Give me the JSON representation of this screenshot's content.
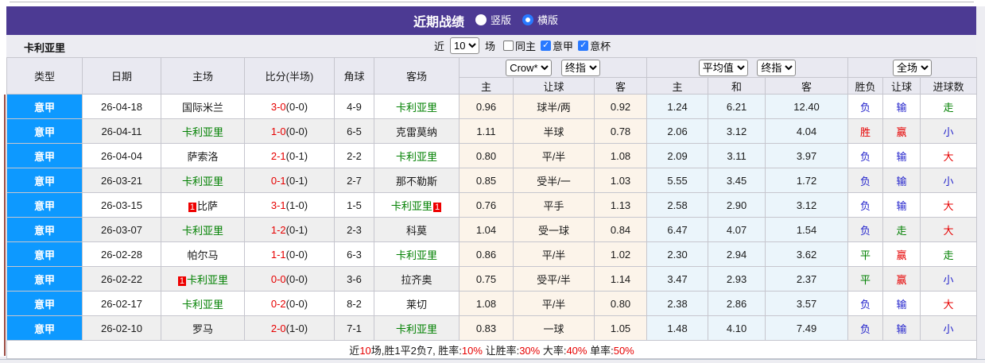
{
  "titlebar": {
    "title": "近期战绩",
    "radios": [
      {
        "label": "竖版",
        "checked": false
      },
      {
        "label": "横版",
        "checked": true
      }
    ]
  },
  "filter": {
    "team": "卡利亚里",
    "near_label": "近",
    "count_value": "10",
    "games_label": "场",
    "checkboxes": [
      {
        "label": "同主",
        "checked": false
      },
      {
        "label": "意甲",
        "checked": true
      },
      {
        "label": "意杯",
        "checked": true
      }
    ]
  },
  "header": {
    "cols": [
      "类型",
      "日期",
      "主场",
      "比分(半场)",
      "角球",
      "客场"
    ],
    "selects": {
      "crow": "Crow*",
      "final1": "终指",
      "avg": "平均值",
      "final2": "终指",
      "full": "全场"
    },
    "sub": [
      "主",
      "让球",
      "客",
      "主",
      "和",
      "客",
      "胜负",
      "让球",
      "进球数"
    ]
  },
  "rows": [
    {
      "league": "意甲",
      "date": "26-04-18",
      "home": "国际米兰",
      "home_color": "black",
      "home_badge_pre": "",
      "home_badge_suf": "",
      "score_ft": "3-0",
      "score_ht": "(0-0)",
      "corners": "4-9",
      "away": "卡利亚里",
      "away_color": "green",
      "away_badge_pre": "",
      "away_badge_suf": "",
      "odd_home": "0.96",
      "odd_line": "球半/两",
      "odd_away": "0.92",
      "avg_home": "1.24",
      "avg_draw": "6.21",
      "avg_away": "12.40",
      "res_wdl": "负",
      "res_wdl_c": "blue",
      "res_let": "输",
      "res_let_c": "blue",
      "res_goal": "走",
      "res_goal_c": "green"
    },
    {
      "league": "意甲",
      "date": "26-04-11",
      "home": "卡利亚里",
      "home_color": "green",
      "home_badge_pre": "",
      "home_badge_suf": "",
      "score_ft": "1-0",
      "score_ht": "(0-0)",
      "corners": "6-5",
      "away": "克雷莫纳",
      "away_color": "black",
      "away_badge_pre": "",
      "away_badge_suf": "",
      "odd_home": "1.11",
      "odd_line": "半球",
      "odd_away": "0.78",
      "avg_home": "2.06",
      "avg_draw": "3.12",
      "avg_away": "4.04",
      "res_wdl": "胜",
      "res_wdl_c": "red",
      "res_let": "赢",
      "res_let_c": "red",
      "res_goal": "小",
      "res_goal_c": "blue"
    },
    {
      "league": "意甲",
      "date": "26-04-04",
      "home": "萨索洛",
      "home_color": "black",
      "home_badge_pre": "",
      "home_badge_suf": "",
      "score_ft": "2-1",
      "score_ht": "(0-1)",
      "corners": "2-2",
      "away": "卡利亚里",
      "away_color": "green",
      "away_badge_pre": "",
      "away_badge_suf": "",
      "odd_home": "0.80",
      "odd_line": "平/半",
      "odd_away": "1.08",
      "avg_home": "2.09",
      "avg_draw": "3.11",
      "avg_away": "3.97",
      "res_wdl": "负",
      "res_wdl_c": "blue",
      "res_let": "输",
      "res_let_c": "blue",
      "res_goal": "大",
      "res_goal_c": "red"
    },
    {
      "league": "意甲",
      "date": "26-03-21",
      "home": "卡利亚里",
      "home_color": "green",
      "home_badge_pre": "",
      "home_badge_suf": "",
      "score_ft": "0-1",
      "score_ht": "(0-1)",
      "corners": "2-7",
      "away": "那不勒斯",
      "away_color": "black",
      "away_badge_pre": "",
      "away_badge_suf": "",
      "odd_home": "0.85",
      "odd_line": "受半/一",
      "odd_away": "1.03",
      "avg_home": "5.55",
      "avg_draw": "3.45",
      "avg_away": "1.72",
      "res_wdl": "负",
      "res_wdl_c": "blue",
      "res_let": "输",
      "res_let_c": "blue",
      "res_goal": "小",
      "res_goal_c": "blue"
    },
    {
      "league": "意甲",
      "date": "26-03-15",
      "home": "比萨",
      "home_color": "black",
      "home_badge_pre": "1",
      "home_badge_suf": "",
      "score_ft": "3-1",
      "score_ht": "(1-0)",
      "corners": "1-5",
      "away": "卡利亚里",
      "away_color": "green",
      "away_badge_pre": "",
      "away_badge_suf": "1",
      "odd_home": "0.76",
      "odd_line": "平手",
      "odd_away": "1.13",
      "avg_home": "2.58",
      "avg_draw": "2.90",
      "avg_away": "3.12",
      "res_wdl": "负",
      "res_wdl_c": "blue",
      "res_let": "输",
      "res_let_c": "blue",
      "res_goal": "大",
      "res_goal_c": "red"
    },
    {
      "league": "意甲",
      "date": "26-03-07",
      "home": "卡利亚里",
      "home_color": "green",
      "home_badge_pre": "",
      "home_badge_suf": "",
      "score_ft": "1-2",
      "score_ht": "(0-1)",
      "corners": "2-3",
      "away": "科莫",
      "away_color": "black",
      "away_badge_pre": "",
      "away_badge_suf": "",
      "odd_home": "1.04",
      "odd_line": "受一球",
      "odd_away": "0.84",
      "avg_home": "6.47",
      "avg_draw": "4.07",
      "avg_away": "1.54",
      "res_wdl": "负",
      "res_wdl_c": "blue",
      "res_let": "走",
      "res_let_c": "green",
      "res_goal": "大",
      "res_goal_c": "red"
    },
    {
      "league": "意甲",
      "date": "26-02-28",
      "home": "帕尔马",
      "home_color": "black",
      "home_badge_pre": "",
      "home_badge_suf": "",
      "score_ft": "1-1",
      "score_ht": "(0-0)",
      "corners": "6-3",
      "away": "卡利亚里",
      "away_color": "green",
      "away_badge_pre": "",
      "away_badge_suf": "",
      "odd_home": "0.86",
      "odd_line": "平/半",
      "odd_away": "1.02",
      "avg_home": "2.30",
      "avg_draw": "2.94",
      "avg_away": "3.62",
      "res_wdl": "平",
      "res_wdl_c": "green",
      "res_let": "赢",
      "res_let_c": "red",
      "res_goal": "走",
      "res_goal_c": "green"
    },
    {
      "league": "意甲",
      "date": "26-02-22",
      "home": "卡利亚里",
      "home_color": "green",
      "home_badge_pre": "1",
      "home_badge_suf": "",
      "score_ft": "0-0",
      "score_ht": "(0-0)",
      "corners": "3-6",
      "away": "拉齐奥",
      "away_color": "black",
      "away_badge_pre": "",
      "away_badge_suf": "",
      "odd_home": "0.75",
      "odd_line": "受平/半",
      "odd_away": "1.14",
      "avg_home": "3.47",
      "avg_draw": "2.93",
      "avg_away": "2.37",
      "res_wdl": "平",
      "res_wdl_c": "green",
      "res_let": "赢",
      "res_let_c": "red",
      "res_goal": "小",
      "res_goal_c": "blue"
    },
    {
      "league": "意甲",
      "date": "26-02-17",
      "home": "卡利亚里",
      "home_color": "green",
      "home_badge_pre": "",
      "home_badge_suf": "",
      "score_ft": "0-2",
      "score_ht": "(0-0)",
      "corners": "8-2",
      "away": "莱切",
      "away_color": "black",
      "away_badge_pre": "",
      "away_badge_suf": "",
      "odd_home": "1.08",
      "odd_line": "平/半",
      "odd_away": "0.80",
      "avg_home": "2.38",
      "avg_draw": "2.86",
      "avg_away": "3.57",
      "res_wdl": "负",
      "res_wdl_c": "blue",
      "res_let": "输",
      "res_let_c": "blue",
      "res_goal": "大",
      "res_goal_c": "red"
    },
    {
      "league": "意甲",
      "date": "26-02-10",
      "home": "罗马",
      "home_color": "black",
      "home_badge_pre": "",
      "home_badge_suf": "",
      "score_ft": "2-0",
      "score_ht": "(1-0)",
      "corners": "7-1",
      "away": "卡利亚里",
      "away_color": "green",
      "away_badge_pre": "",
      "away_badge_suf": "",
      "odd_home": "0.83",
      "odd_line": "一球",
      "odd_away": "1.05",
      "avg_home": "1.48",
      "avg_draw": "4.10",
      "avg_away": "7.49",
      "res_wdl": "负",
      "res_wdl_c": "blue",
      "res_let": "输",
      "res_let_c": "blue",
      "res_goal": "小",
      "res_goal_c": "blue"
    }
  ],
  "footer": {
    "segments": [
      {
        "text": "近",
        "color": "black"
      },
      {
        "text": "10",
        "color": "red"
      },
      {
        "text": "场,胜1平2负7, 胜率:",
        "color": "black"
      },
      {
        "text": "10%",
        "color": "red"
      },
      {
        "text": " 让胜率:",
        "color": "black"
      },
      {
        "text": "30%",
        "color": "red"
      },
      {
        "text": " 大率:",
        "color": "black"
      },
      {
        "text": "40%",
        "color": "red"
      },
      {
        "text": " 单率:",
        "color": "black"
      },
      {
        "text": "50%",
        "color": "red"
      }
    ]
  },
  "colors": {
    "titlebar": "#4c3a93",
    "league_cell": "#0d99ff",
    "win_red": "#e60000",
    "loss_blue": "#2323cc",
    "draw_green": "#008000",
    "cream_bg": "#fcf4ea",
    "avg_bg": "#ebf5fb"
  }
}
